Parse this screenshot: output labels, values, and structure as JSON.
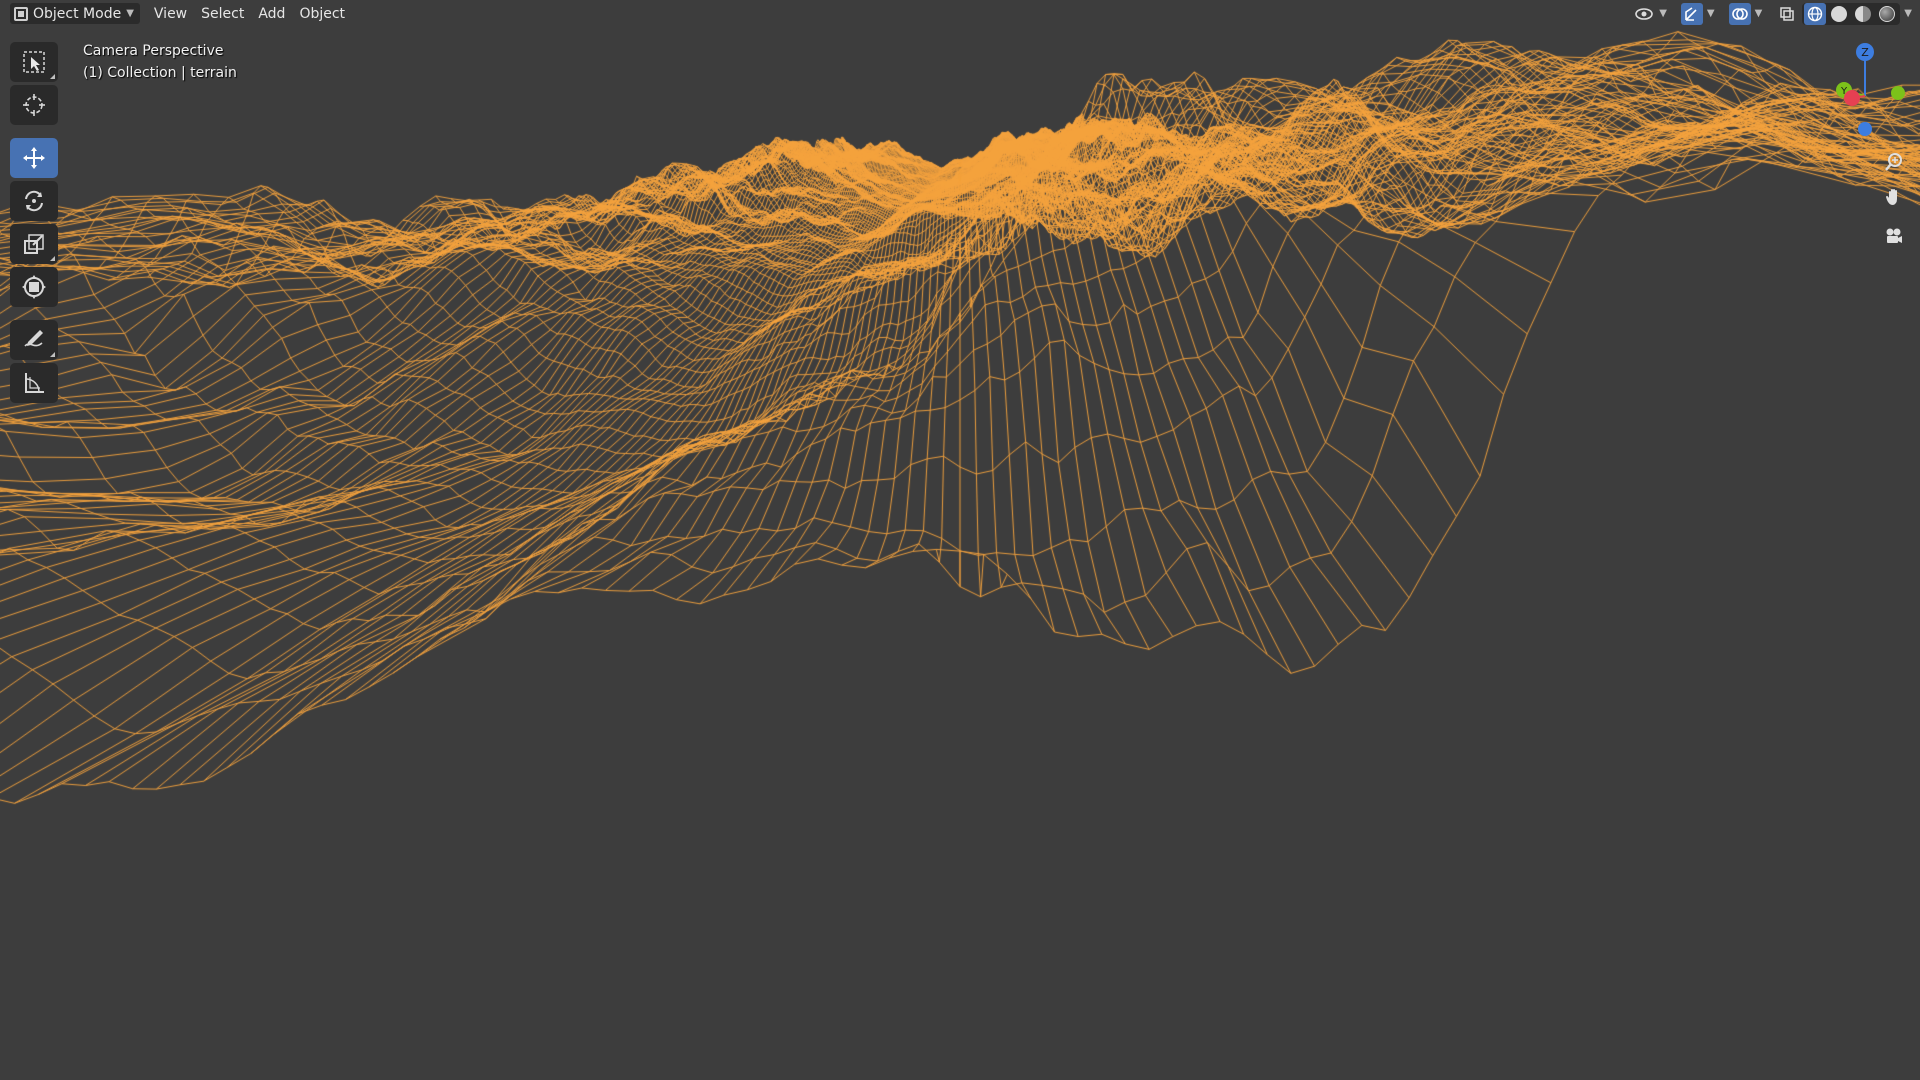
{
  "header": {
    "mode_label": "Object Mode",
    "menus": [
      "View",
      "Select",
      "Add",
      "Object"
    ]
  },
  "overlay": {
    "line1": "Camera Perspective",
    "line2": "(1) Collection | terrain"
  },
  "toolbar": {
    "tools": [
      {
        "name": "select-box",
        "active": false
      },
      {
        "name": "cursor",
        "active": false
      },
      {
        "name": "move",
        "active": true
      },
      {
        "name": "rotate",
        "active": false
      },
      {
        "name": "scale",
        "active": false
      },
      {
        "name": "transform",
        "active": false
      },
      {
        "name": "annotate",
        "active": false
      },
      {
        "name": "measure",
        "active": false
      }
    ]
  },
  "gizmo": {
    "axes": {
      "x": "X",
      "y": "Y",
      "z": "Z"
    },
    "colors": {
      "x": "#e64052",
      "y": "#7cc21a",
      "z": "#3d7de0"
    }
  },
  "colors": {
    "wire": "#f4a23c",
    "background": "#3d3d3d",
    "accent": "#4772b3"
  }
}
